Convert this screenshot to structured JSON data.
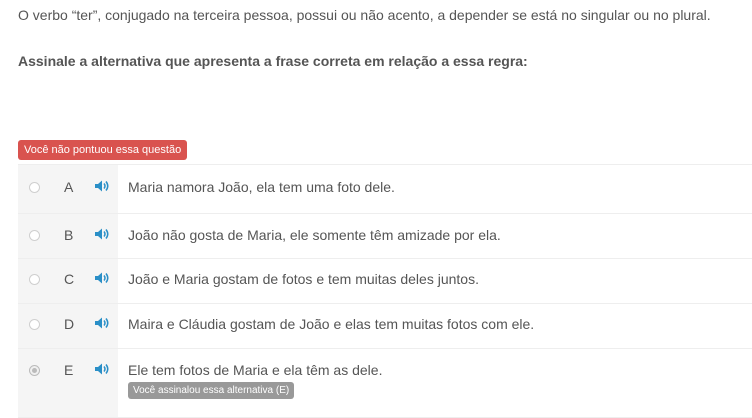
{
  "question": {
    "statement": "O verbo “ter”, conjugado na terceira pessoa, possui ou não acento, a depender se está no singular ou no plural.",
    "prompt": "Assinale a alternativa que apresenta a frase correta em relação a essa regra:"
  },
  "result_badge": "Você não pontuou essa questão",
  "options": [
    {
      "letter": "A",
      "text": "Maria namora João, ela tem uma foto dele.",
      "selected": false
    },
    {
      "letter": "B",
      "text": "João não gosta de Maria, ele somente têm amizade por ela.",
      "selected": false
    },
    {
      "letter": "C",
      "text": "João e Maria gostam de fotos e tem muitas deles juntos.",
      "selected": false
    },
    {
      "letter": "D",
      "text": "Maira e Cláudia gostam de João e elas tem muitas fotos com ele.",
      "selected": false
    },
    {
      "letter": "E",
      "text": "Ele tem fotos de Maria e ela têm as dele.",
      "selected": true,
      "selected_label": "Você assinalou essa alternativa (E)"
    }
  ],
  "colors": {
    "wrong_badge": "#d9534f",
    "selected_badge": "#999999",
    "speaker_icon": "#2a8fc7",
    "option_left_bg": "#f5f5f5"
  },
  "icons": {
    "audio": "speaker-icon"
  }
}
